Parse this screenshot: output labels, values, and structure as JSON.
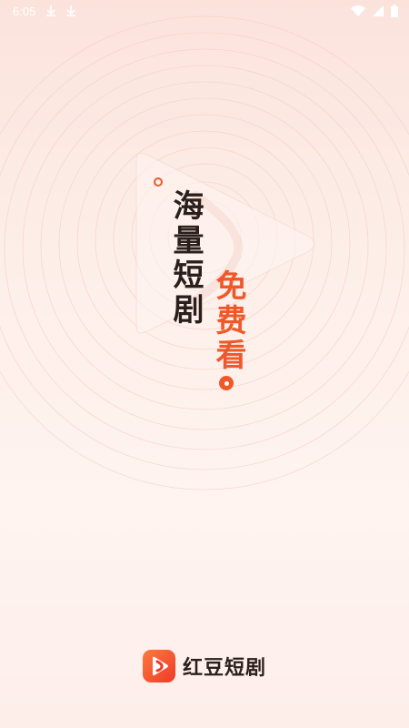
{
  "status_bar": {
    "time": "6:05",
    "icons": [
      "download-icon",
      "download-icon",
      "wifi-icon",
      "signal-icon",
      "battery-icon"
    ],
    "text_color": "#ffffff"
  },
  "slogan": {
    "line1": "海量短剧",
    "line2": "免费看"
  },
  "brand": {
    "name": "红豆短剧",
    "logo_icon": "play-logo-icon"
  },
  "colors": {
    "accent": "#f0582a",
    "text_dark": "#2a1f1c",
    "background": "#fdeee8"
  }
}
